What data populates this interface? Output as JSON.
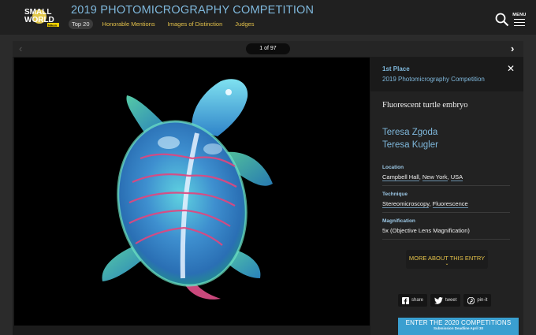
{
  "header": {
    "logo": {
      "line1": "SMALL",
      "line2": "WORLD",
      "sub": "Nikon"
    },
    "title": "2019 PHOTOMICROGRAPHY COMPETITION",
    "nav": [
      {
        "label": "Top 20",
        "active": true
      },
      {
        "label": "Honorable Mentions"
      },
      {
        "label": "Images of Distinction"
      },
      {
        "label": "Judges"
      }
    ],
    "search_icon": "search-icon",
    "menu_label": "MENU"
  },
  "viewer": {
    "counter": "1 of 97",
    "prev_icon": "‹",
    "next_icon": "›"
  },
  "entry": {
    "rank": "1st Place",
    "competition": "2019 Photomicrography Competition",
    "close_icon": "✕",
    "title": "Fluorescent turtle embryo",
    "authors": [
      "Teresa Zgoda",
      "Teresa Kugler"
    ],
    "location_label": "Location",
    "location_parts": [
      "Campbell Hall",
      ", ",
      "New York",
      ", ",
      "USA"
    ],
    "technique_label": "Technique",
    "technique_parts": [
      "Stereomicroscopy",
      ", ",
      "Fluorescence"
    ],
    "magnification_label": "Magnification",
    "magnification": "5x (Objective Lens Magnification)",
    "more_label": "MORE ABOUT THIS ENTRY",
    "more_chevron": "⌄"
  },
  "share": [
    {
      "label": "share",
      "icon": "facebook-icon"
    },
    {
      "label": "tweet",
      "icon": "twitter-icon"
    },
    {
      "label": "pin-it",
      "icon": "pinterest-icon"
    }
  ],
  "cta": {
    "label": "ENTER THE 2020 COMPETITIONS",
    "sub": "Submission Deadline April 30"
  },
  "colors": {
    "accent_blue": "#7fb8dc",
    "accent_gold": "#e4c24a",
    "cta_blue": "#3a9fd0"
  }
}
